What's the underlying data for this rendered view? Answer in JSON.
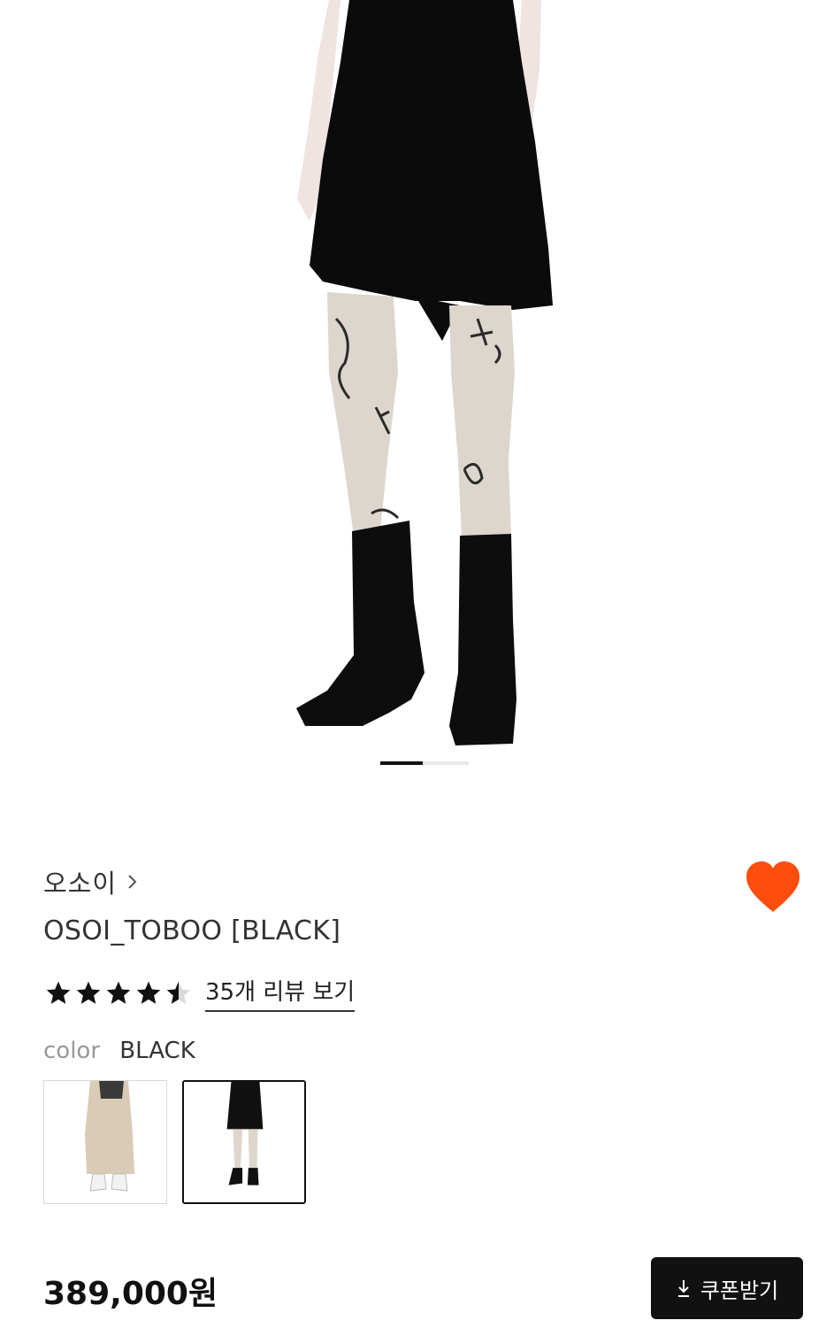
{
  "product": {
    "brand": "오소이",
    "title": "OSOI_TOBOO [BLACK]",
    "rating": 4.5,
    "review_link": "35개 리뷰 보기",
    "color_label": "color",
    "color_value": "BLACK",
    "price": "389,000원"
  },
  "gallery": {
    "current_slide": 1
  },
  "swatches": [
    {
      "name": "beige-variant",
      "selected": false
    },
    {
      "name": "black-variant",
      "selected": true
    }
  ],
  "actions": {
    "coupon_label": "쿠폰받기"
  },
  "colors": {
    "heart": "#ff4d0d",
    "button": "#111111",
    "link": "#222222"
  },
  "icons": [
    "chevron-right-icon",
    "heart-icon",
    "star-icon",
    "download-icon"
  ]
}
